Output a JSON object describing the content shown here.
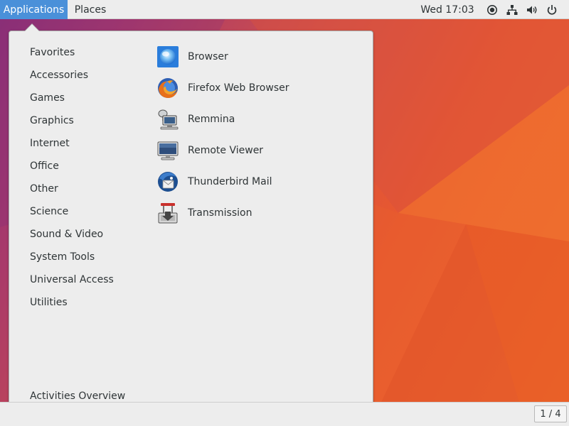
{
  "topbar": {
    "applications_label": "Applications",
    "places_label": "Places",
    "clock": "Wed 17:03"
  },
  "tray_icons": [
    "accessibility-icon",
    "network-icon",
    "volume-icon",
    "power-icon"
  ],
  "menu": {
    "categories": [
      "Favorites",
      "Accessories",
      "Games",
      "Graphics",
      "Internet",
      "Office",
      "Other",
      "Science",
      "Sound & Video",
      "System Tools",
      "Universal Access",
      "Utilities"
    ],
    "apps": [
      {
        "label": "Browser",
        "icon": "browser-icon"
      },
      {
        "label": "Firefox Web Browser",
        "icon": "firefox-icon"
      },
      {
        "label": "Remmina",
        "icon": "remmina-icon"
      },
      {
        "label": "Remote Viewer",
        "icon": "remote-viewer-icon"
      },
      {
        "label": "Thunderbird Mail",
        "icon": "thunderbird-icon"
      },
      {
        "label": "Transmission",
        "icon": "transmission-icon"
      }
    ],
    "activities_overview": "Activities Overview"
  },
  "bottombar": {
    "workspace": "1 / 4"
  },
  "colors": {
    "topbar_bg": "#ededed",
    "accent": "#4a90d9",
    "menu_bg": "#ededed",
    "text": "#2e3436"
  }
}
